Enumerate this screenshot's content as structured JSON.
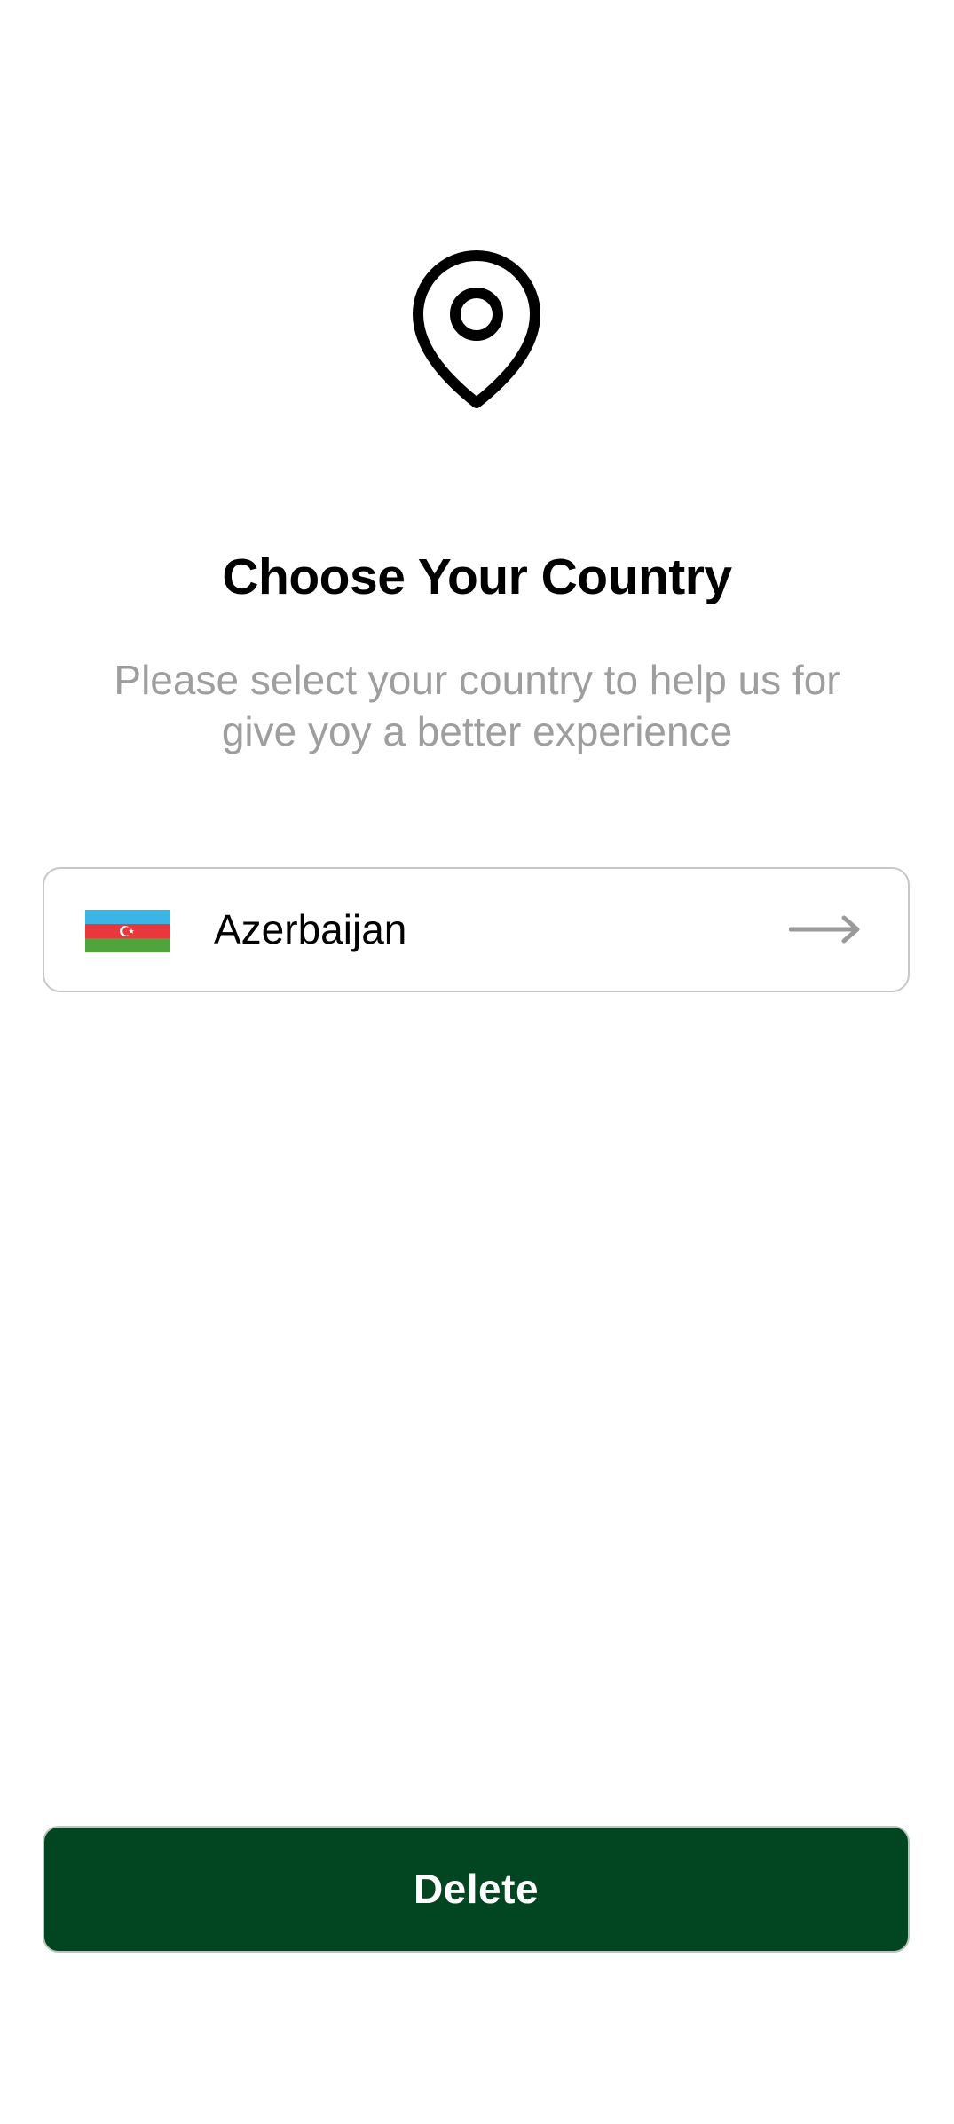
{
  "header": {
    "icon": "location-pin-icon",
    "title": "Choose Your Country",
    "subtitle": "Please select your country to help us for give yoy a better experience"
  },
  "country_selector": {
    "flag_icon": "azerbaijan-flag-icon",
    "country": "Azerbaijan",
    "arrow_icon": "arrow-right-icon"
  },
  "actions": {
    "delete_label": "Delete"
  },
  "colors": {
    "primary": "#014621",
    "subtitle": "#9e9e9e",
    "border": "#c8c8c8"
  }
}
